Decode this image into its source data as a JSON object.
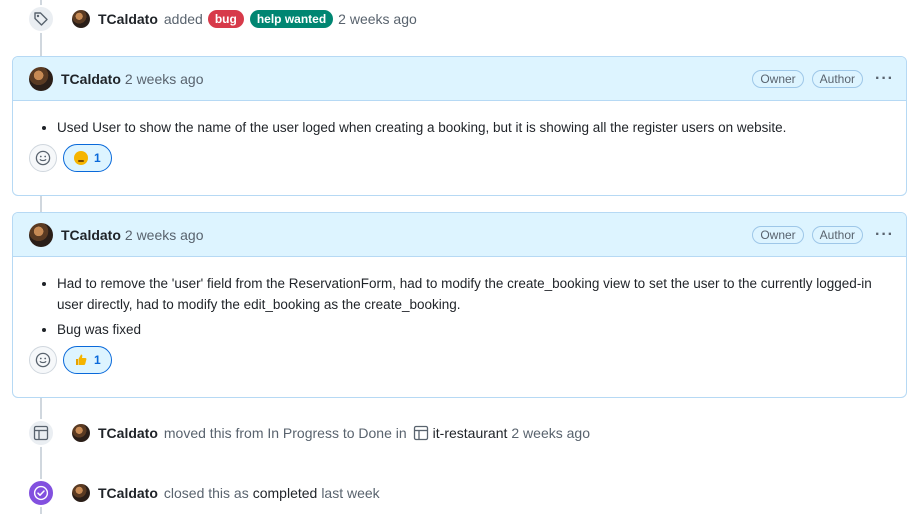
{
  "events": {
    "labeled": {
      "actor": "TCaldato",
      "verb": "added",
      "labels": [
        "bug",
        "help wanted"
      ],
      "time": "2 weeks ago"
    },
    "moved": {
      "actor": "TCaldato",
      "text_before": "moved this from In Progress to Done in",
      "project": "it-restaurant",
      "time": "2 weeks ago"
    },
    "closed": {
      "actor": "TCaldato",
      "text_before": "closed this as",
      "state": "completed",
      "time": "last week"
    }
  },
  "comments": [
    {
      "author": "TCaldato",
      "time": "2 weeks ago",
      "roles": [
        "Owner",
        "Author"
      ],
      "items": [
        "Used User to show the name of the user loged when creating a booking, but it is showing all the register users on website."
      ],
      "reaction": {
        "emoji": "confused",
        "count": "1"
      }
    },
    {
      "author": "TCaldato",
      "time": "2 weeks ago",
      "roles": [
        "Owner",
        "Author"
      ],
      "items": [
        "Had to remove the 'user' field from the ReservationForm, had to modify the create_booking view to set the user to the currently logged-in user directly, had to modify the edit_booking as the create_booking.",
        "Bug was fixed"
      ],
      "reaction": {
        "emoji": "thumbs-up",
        "count": "1"
      }
    }
  ],
  "icons": {
    "tag": "tag-icon",
    "table": "table-icon",
    "check": "check-circle-icon",
    "smiley": "smiley-icon",
    "kebab": "kebab-horizontal-icon"
  },
  "colors": {
    "accent": "#0969da",
    "header_bg": "#ddf4ff",
    "bug_label": "#d73a4a",
    "help_label": "#008672",
    "closed_badge": "#8250df"
  }
}
